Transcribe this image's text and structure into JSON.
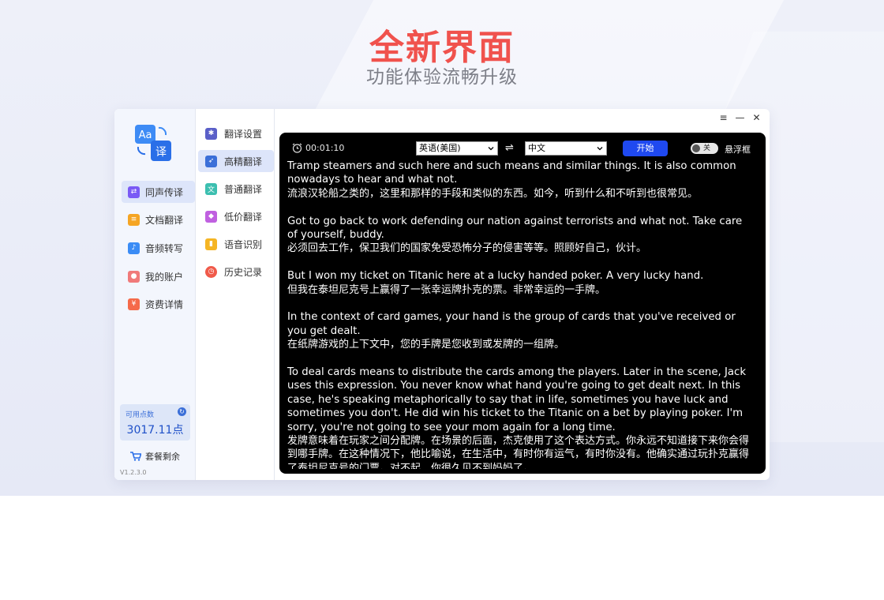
{
  "hero": {
    "title": "全新界面",
    "subtitle": "功能体验流畅升级"
  },
  "sidebar": {
    "items": [
      {
        "label": "同声传译",
        "icon": "interpret-icon",
        "color": "#7a5af5",
        "active": true
      },
      {
        "label": "文档翻译",
        "icon": "document-icon",
        "color": "#f5a524",
        "active": false
      },
      {
        "label": "音频转写",
        "icon": "audio-icon",
        "color": "#3b8cf5",
        "active": false
      },
      {
        "label": "我的账户",
        "icon": "account-icon",
        "color": "#f07a7a",
        "active": false
      },
      {
        "label": "资费详情",
        "icon": "pricing-icon",
        "color": "#f56a4a",
        "active": false
      }
    ],
    "points_label": "可用点数",
    "points_value": "3017.11点",
    "package_label": "套餐剩余",
    "version": "V1.2.3.0"
  },
  "subnav": {
    "items": [
      {
        "label": "翻译设置",
        "icon": "gear-icon",
        "color": "#5a5fc8",
        "active": false
      },
      {
        "label": "高精翻译",
        "icon": "rocket-icon",
        "color": "#3b6fd8",
        "active": true
      },
      {
        "label": "普通翻译",
        "icon": "translate-icon",
        "color": "#3cbfb0",
        "active": false
      },
      {
        "label": "低价翻译",
        "icon": "tag-icon",
        "color": "#c060e0",
        "active": false
      },
      {
        "label": "语音识别",
        "icon": "microphone-icon",
        "color": "#f5b524",
        "active": false
      },
      {
        "label": "历史记录",
        "icon": "clock-icon",
        "color": "#f05a4a",
        "active": false
      }
    ]
  },
  "panel": {
    "timer": "00:01:10",
    "source_lang": "英语(美国)",
    "swap_glyph": "⇌",
    "target_lang": "中文",
    "start_label": "开始",
    "toggle_label": "关",
    "float_label": "悬浮框",
    "paragraphs": [
      {
        "en": "Tramp steamers and such here and such means and similar things. It is also common nowadays to hear and what not.",
        "zh": "流浪汉轮船之类的，这里和那样的手段和类似的东西。如今，听到什么和不听到也很常见。"
      },
      {
        "en": "Got to go back to work defending our nation against terrorists and what not. Take care of yourself, buddy.",
        "zh": "必须回去工作，保卫我们的国家免受恐怖分子的侵害等等。照顾好自己，伙计。"
      },
      {
        "en": "But I won my ticket on Titanic here at a lucky handed poker. A very lucky hand.",
        "zh": "但我在泰坦尼克号上赢得了一张幸运牌扑克的票。非常幸运的一手牌。"
      },
      {
        "en": "In the context of card games, your hand is the group of cards that you've received or you get dealt.",
        "zh": "在纸牌游戏的上下文中，您的手牌是您收到或发牌的一组牌。"
      },
      {
        "en": "To deal cards means to distribute the cards among the players. Later in the scene, Jack uses this expression. You never know what hand you're going to get dealt next. In this case, he's speaking metaphorically to say that in life, sometimes you have luck and sometimes you don't. He did win his ticket to the Titanic on a bet by playing poker. I'm sorry, you're not going to see your mom again for a long time.",
        "zh": "发牌意味着在玩家之间分配牌。在场景的后面，杰克使用了这个表达方式。你永远不知道接下来你会得到哪手牌。在这种情况下，他比喻说，在生活中，有时你有运气，有时你没有。他确实通过玩扑克赢得了泰坦尼克号的门票。对不起，你很久见不到妈妈了。"
      }
    ]
  },
  "colors": {
    "accent": "#1f49f0",
    "title_red": "#f0524d",
    "active_bg": "#dde5fa"
  }
}
